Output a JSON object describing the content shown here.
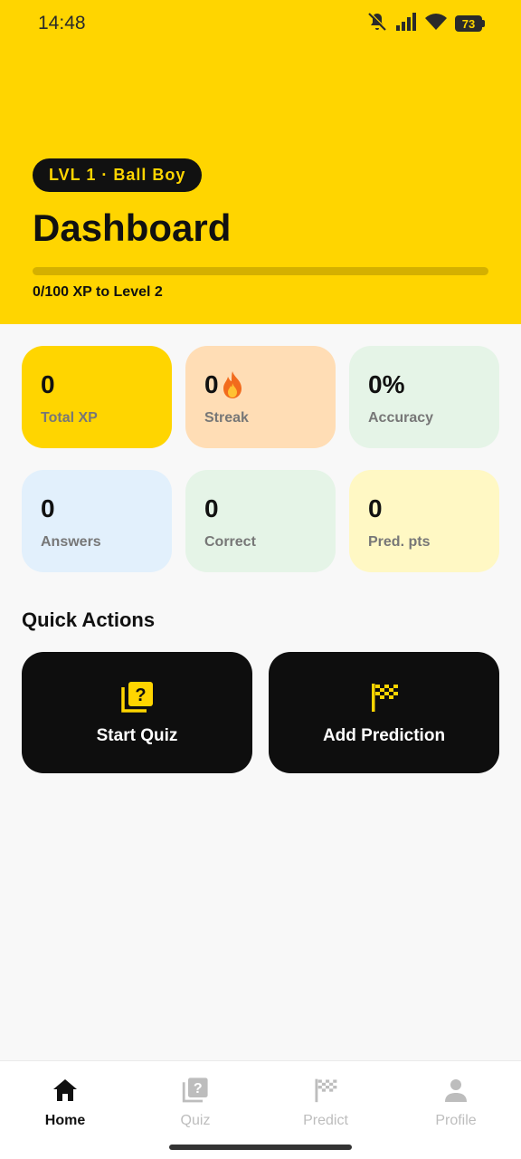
{
  "status_bar": {
    "time": "14:48",
    "battery": "73",
    "icons": [
      "bell-muted-icon",
      "signal-icon",
      "wifi-icon",
      "battery-icon"
    ]
  },
  "header": {
    "level_badge": "LVL 1 · Ball Boy",
    "title": "Dashboard",
    "xp_progress_fraction": 0,
    "xp_text": "0/100 XP to Level 2",
    "background_color": "#FFD500"
  },
  "stats": [
    {
      "value": "0",
      "label": "Total XP",
      "color": "#FFD500"
    },
    {
      "value": "0",
      "label": "Streak",
      "color": "#FFDDB5",
      "icon": "flame-icon"
    },
    {
      "value": "0%",
      "label": "Accuracy",
      "color": "#E5F4E7"
    },
    {
      "value": "0",
      "label": "Answers",
      "color": "#E2F0FC"
    },
    {
      "value": "0",
      "label": "Correct",
      "color": "#E5F4E7"
    },
    {
      "value": "0",
      "label": "Pred. pts",
      "color": "#FFF8C4"
    }
  ],
  "quick_actions": {
    "title": "Quick Actions",
    "items": [
      {
        "label": "Start Quiz",
        "icon": "quiz-icon"
      },
      {
        "label": "Add Prediction",
        "icon": "checkered-flag-icon"
      }
    ]
  },
  "bottom_nav": {
    "items": [
      {
        "label": "Home",
        "icon": "home-icon",
        "active": true
      },
      {
        "label": "Quiz",
        "icon": "quiz-icon",
        "active": false
      },
      {
        "label": "Predict",
        "icon": "checkered-flag-icon",
        "active": false
      },
      {
        "label": "Profile",
        "icon": "person-icon",
        "active": false
      }
    ]
  }
}
